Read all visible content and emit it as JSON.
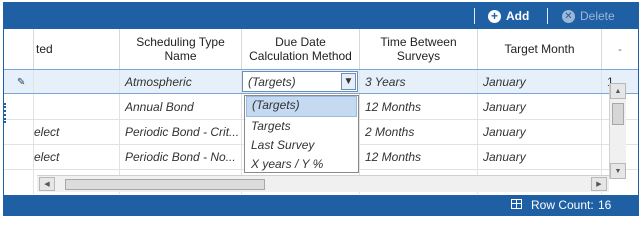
{
  "toolbar": {
    "add_label": "Add",
    "delete_label": "Delete",
    "add_icon": "plus-circle-icon",
    "delete_icon": "close-circle-icon"
  },
  "columns": [
    {
      "label": "ted"
    },
    {
      "label": "Scheduling Type Name"
    },
    {
      "label": "Due Date Calculation Method"
    },
    {
      "label": "Time Between Surveys"
    },
    {
      "label": "Target Month"
    }
  ],
  "rows": [
    {
      "c0": "",
      "scheduling_type": "Atmospheric",
      "due_date_method": "(Targets)",
      "time_between": "3 Years",
      "target_month": "January",
      "extra": "1"
    },
    {
      "c0": "",
      "scheduling_type": "Annual Bond",
      "due_date_method": "",
      "time_between": "12 Months",
      "target_month": "January",
      "extra": ""
    },
    {
      "c0": "elect",
      "scheduling_type": "Periodic Bond - Crit...",
      "due_date_method": "",
      "time_between": "2 Months",
      "target_month": "January",
      "extra": ""
    },
    {
      "c0": "elect",
      "scheduling_type": "Periodic Bond - No...",
      "due_date_method": "",
      "time_between": "12 Months",
      "target_month": "January",
      "extra": ""
    }
  ],
  "dropdown": {
    "selected": "(Targets)",
    "options": [
      "(Targets)",
      "Targets",
      "Last Survey",
      "X years / Y %"
    ]
  },
  "footer": {
    "row_count_label": "Row Count:",
    "row_count_value": "16"
  },
  "colors": {
    "brand_blue": "#1f5fa3",
    "selection": "#e6f0fa",
    "dropdown_highlight": "#c5daf0"
  }
}
